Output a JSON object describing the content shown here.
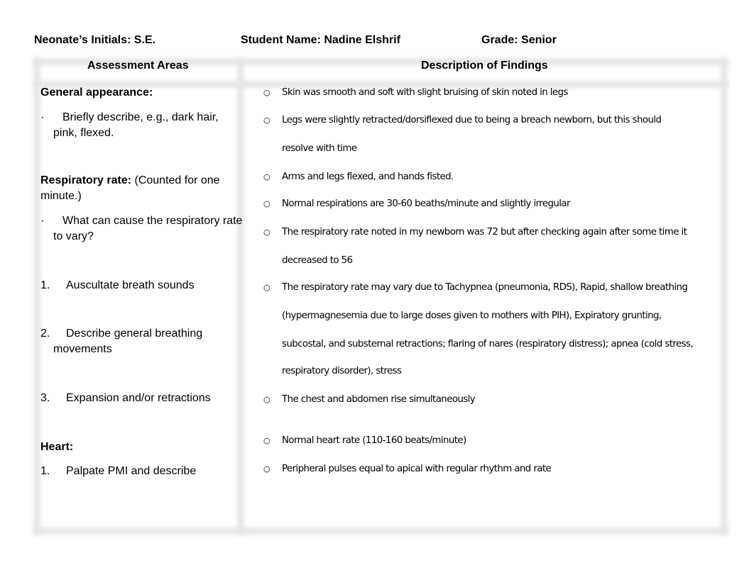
{
  "header": {
    "neonate_initials": "Neonate’s Initials: S.E.",
    "student_name": "Student Name: Nadine Elshrif",
    "grade": "Grade: Senior"
  },
  "table": {
    "columns": [
      "Assessment Areas",
      "Description of Findings"
    ],
    "assessment": {
      "general_title": "General appearance:",
      "general_bullet_marker": "·",
      "general_bullet": "Briefly describe, e.g., dark hair, pink, flexed.",
      "resp_title": "Respiratory rate:",
      "resp_note": " (Counted for one minute.)",
      "resp_bullet_marker": "·",
      "resp_bullet": "What can cause the respiratory rate to vary?",
      "resp_items": [
        {
          "num": "1.",
          "text": "Auscultate breath sounds"
        },
        {
          "num": "2.",
          "text": "Describe general breathing movements"
        },
        {
          "num": "3.",
          "text": "Expansion and/or retractions"
        }
      ],
      "heart_title": "Heart:",
      "heart_items": [
        {
          "num": "1.",
          "text": "Palpate PMI and describe"
        }
      ]
    },
    "findings": {
      "bullet": "○",
      "lines": [
        "Skin was smooth and soft with slight bruising of skin noted in legs",
        "Legs were slightly retracted/dorsiflexed due to being a breach newborn, but this should",
        "resolve with time",
        "Arms and legs flexed, and hands fisted.",
        "Normal respirations are 30-60 beaths/minute and slightly irregular",
        "The respiratory rate noted in my newborn was 72 but after checking again after some time it",
        "decreased to 56",
        "The respiratory rate may vary due to Tachypnea (pneumonia, RDS), Rapid, shallow breathing",
        "(hypermagnesemia due to large doses given to mothers with PIH), Expiratory grunting,",
        "subcostal, and substernal retractions; flaring of nares (respiratory distress); apnea (cold stress,",
        "respiratory disorder), stress",
        "The chest and abdomen rise simultaneously",
        "Normal heart rate (110-160 beats/minute)",
        "Peripheral pulses equal to apical with regular rhythm and rate"
      ]
    }
  }
}
